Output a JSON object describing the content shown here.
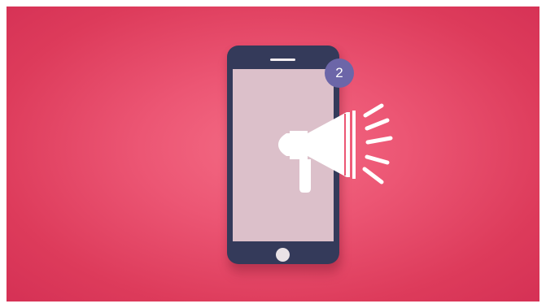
{
  "notification": {
    "badge_count": "2"
  },
  "colors": {
    "background_center": "#f46c85",
    "background_edge": "#d53155",
    "phone_body": "#343a5a",
    "phone_screen": "#dcc0ca",
    "badge": "#6c66a8",
    "icon": "#ffffff"
  },
  "icons": [
    "megaphone-icon",
    "sound-waves-icon"
  ]
}
